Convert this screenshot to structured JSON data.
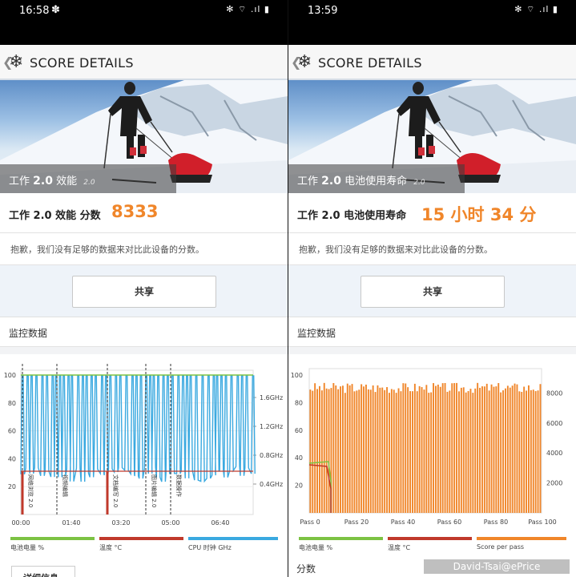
{
  "left": {
    "status": {
      "time": "16:58",
      "gear": "✽",
      "icons": "✻ ⌔ .ıl ▮"
    },
    "header": {
      "back": "❮",
      "title": "SCORE DETAILS"
    },
    "hero": {
      "label_pre": "工作",
      "label_version": "2.0",
      "label_post": " 效能",
      "label_small": "2.0"
    },
    "score": {
      "label": "工作 2.0 效能 分数",
      "value": "8333"
    },
    "note": "抱歉，我们没有足够的数据来对比此设备的分数。",
    "share": "共享",
    "monitor_title": "监控数据",
    "legend": [
      "电池电量 %",
      "温度 °C",
      "CPU 时钟 GHz"
    ],
    "bottom_button": "详细信息",
    "chart_data": {
      "type": "line",
      "y_left_ticks": [
        "100",
        "80",
        "60",
        "40",
        "20"
      ],
      "y_right_ticks": [
        "1.6GHz",
        "1.2GHz",
        "0.8GHz",
        "0.4GHz"
      ],
      "x_ticks": [
        "00:00",
        "01:40",
        "03:20",
        "05:00",
        "06:40"
      ],
      "segments": [
        "网络浏览 2.0",
        "视频编辑",
        "文档编写 2.0",
        "图片编辑 2.0",
        "数据操作"
      ],
      "series": [
        {
          "name": "电池电量 %",
          "color": "#7cc243"
        },
        {
          "name": "温度 °C",
          "color": "#c0392b"
        },
        {
          "name": "CPU 时钟 GHz",
          "color": "#3aa9e0"
        }
      ]
    }
  },
  "right": {
    "status": {
      "time": "13:59",
      "icons": "✻ ⌔ .ıl ▮"
    },
    "header": {
      "back": "❮",
      "title": "SCORE DETAILS"
    },
    "hero": {
      "label_pre": "工作",
      "label_version": "2.0",
      "label_post": " 电池使用寿命",
      "label_small": "2.0"
    },
    "score": {
      "label": "工作 2.0 电池使用寿命",
      "value": "15 小时 34 分"
    },
    "note": "抱歉，我们没有足够的数据来对比此设备的分数。",
    "share": "共享",
    "monitor_title": "监控数据",
    "legend": [
      "电池电量 %",
      "温度 °C",
      "Score per pass"
    ],
    "bottom_heading": "分数",
    "chart_data": {
      "type": "bar",
      "y_left_ticks": [
        "100",
        "80",
        "60",
        "40",
        "20"
      ],
      "y_right_ticks": [
        "8000",
        "6000",
        "4000",
        "2000"
      ],
      "x_ticks": [
        "Pass 0",
        "Pass 20",
        "Pass 40",
        "Pass 60",
        "Pass 80",
        "Pass 100"
      ],
      "bar_color": "#f0862a",
      "passes": 100,
      "approx_score": 8300
    }
  },
  "watermark": "David-Tsai@ePrice"
}
